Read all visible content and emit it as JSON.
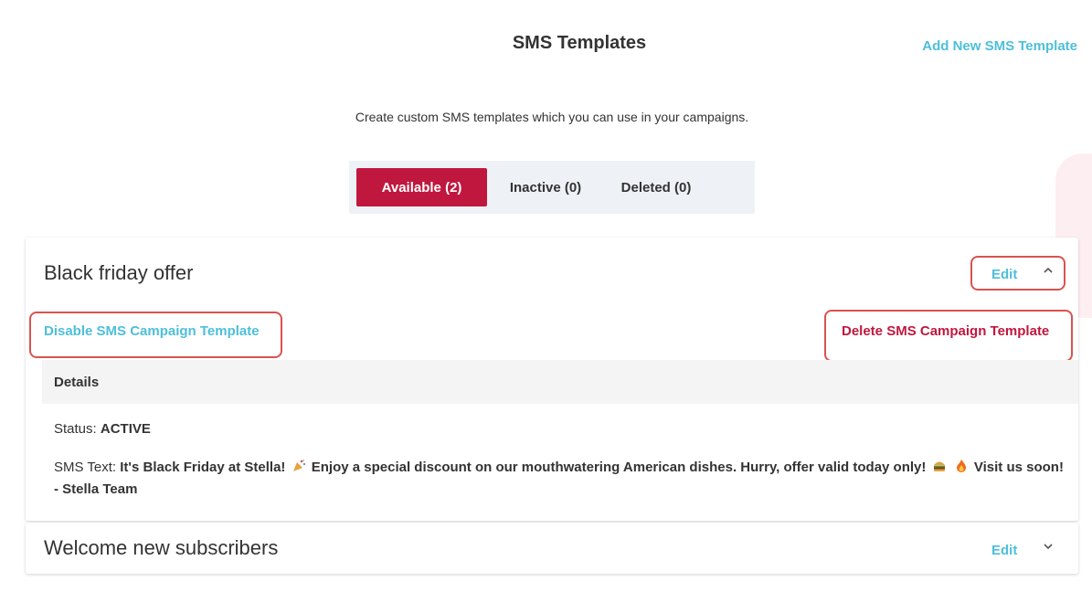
{
  "page": {
    "title": "SMS Templates",
    "add_link": "Add New SMS Template",
    "subtitle": "Create custom SMS templates which you can use in your campaigns."
  },
  "tabs": [
    {
      "label": "Available (2)",
      "active": true
    },
    {
      "label": "Inactive (0)",
      "active": false
    },
    {
      "label": "Deleted (0)",
      "active": false
    }
  ],
  "templates": [
    {
      "title": "Black friday offer",
      "edit_label": "Edit",
      "expanded": true,
      "disable_label": "Disable SMS Campaign Template",
      "delete_label": "Delete SMS Campaign Template",
      "details_label": "Details",
      "status_label": "Status:",
      "status_value": "ACTIVE",
      "sms_label": "SMS Text:",
      "sms_part1": "It's Black Friday at Stella!",
      "sms_part2": "Enjoy a special discount on our mouthwatering American dishes. Hurry, offer valid today only!",
      "sms_part3": "Visit us soon! - Stella Team"
    },
    {
      "title": "Welcome new subscribers",
      "edit_label": "Edit",
      "expanded": false
    }
  ],
  "colors": {
    "accent": "#4dbfd9",
    "brand": "#c0173e",
    "highlight": "#d9534f"
  },
  "icons": {
    "collapse": "chevron-up-icon",
    "expand": "chevron-down-icon",
    "sms_emojis": [
      "party-popper-icon",
      "burger-icon",
      "fire-icon"
    ]
  }
}
